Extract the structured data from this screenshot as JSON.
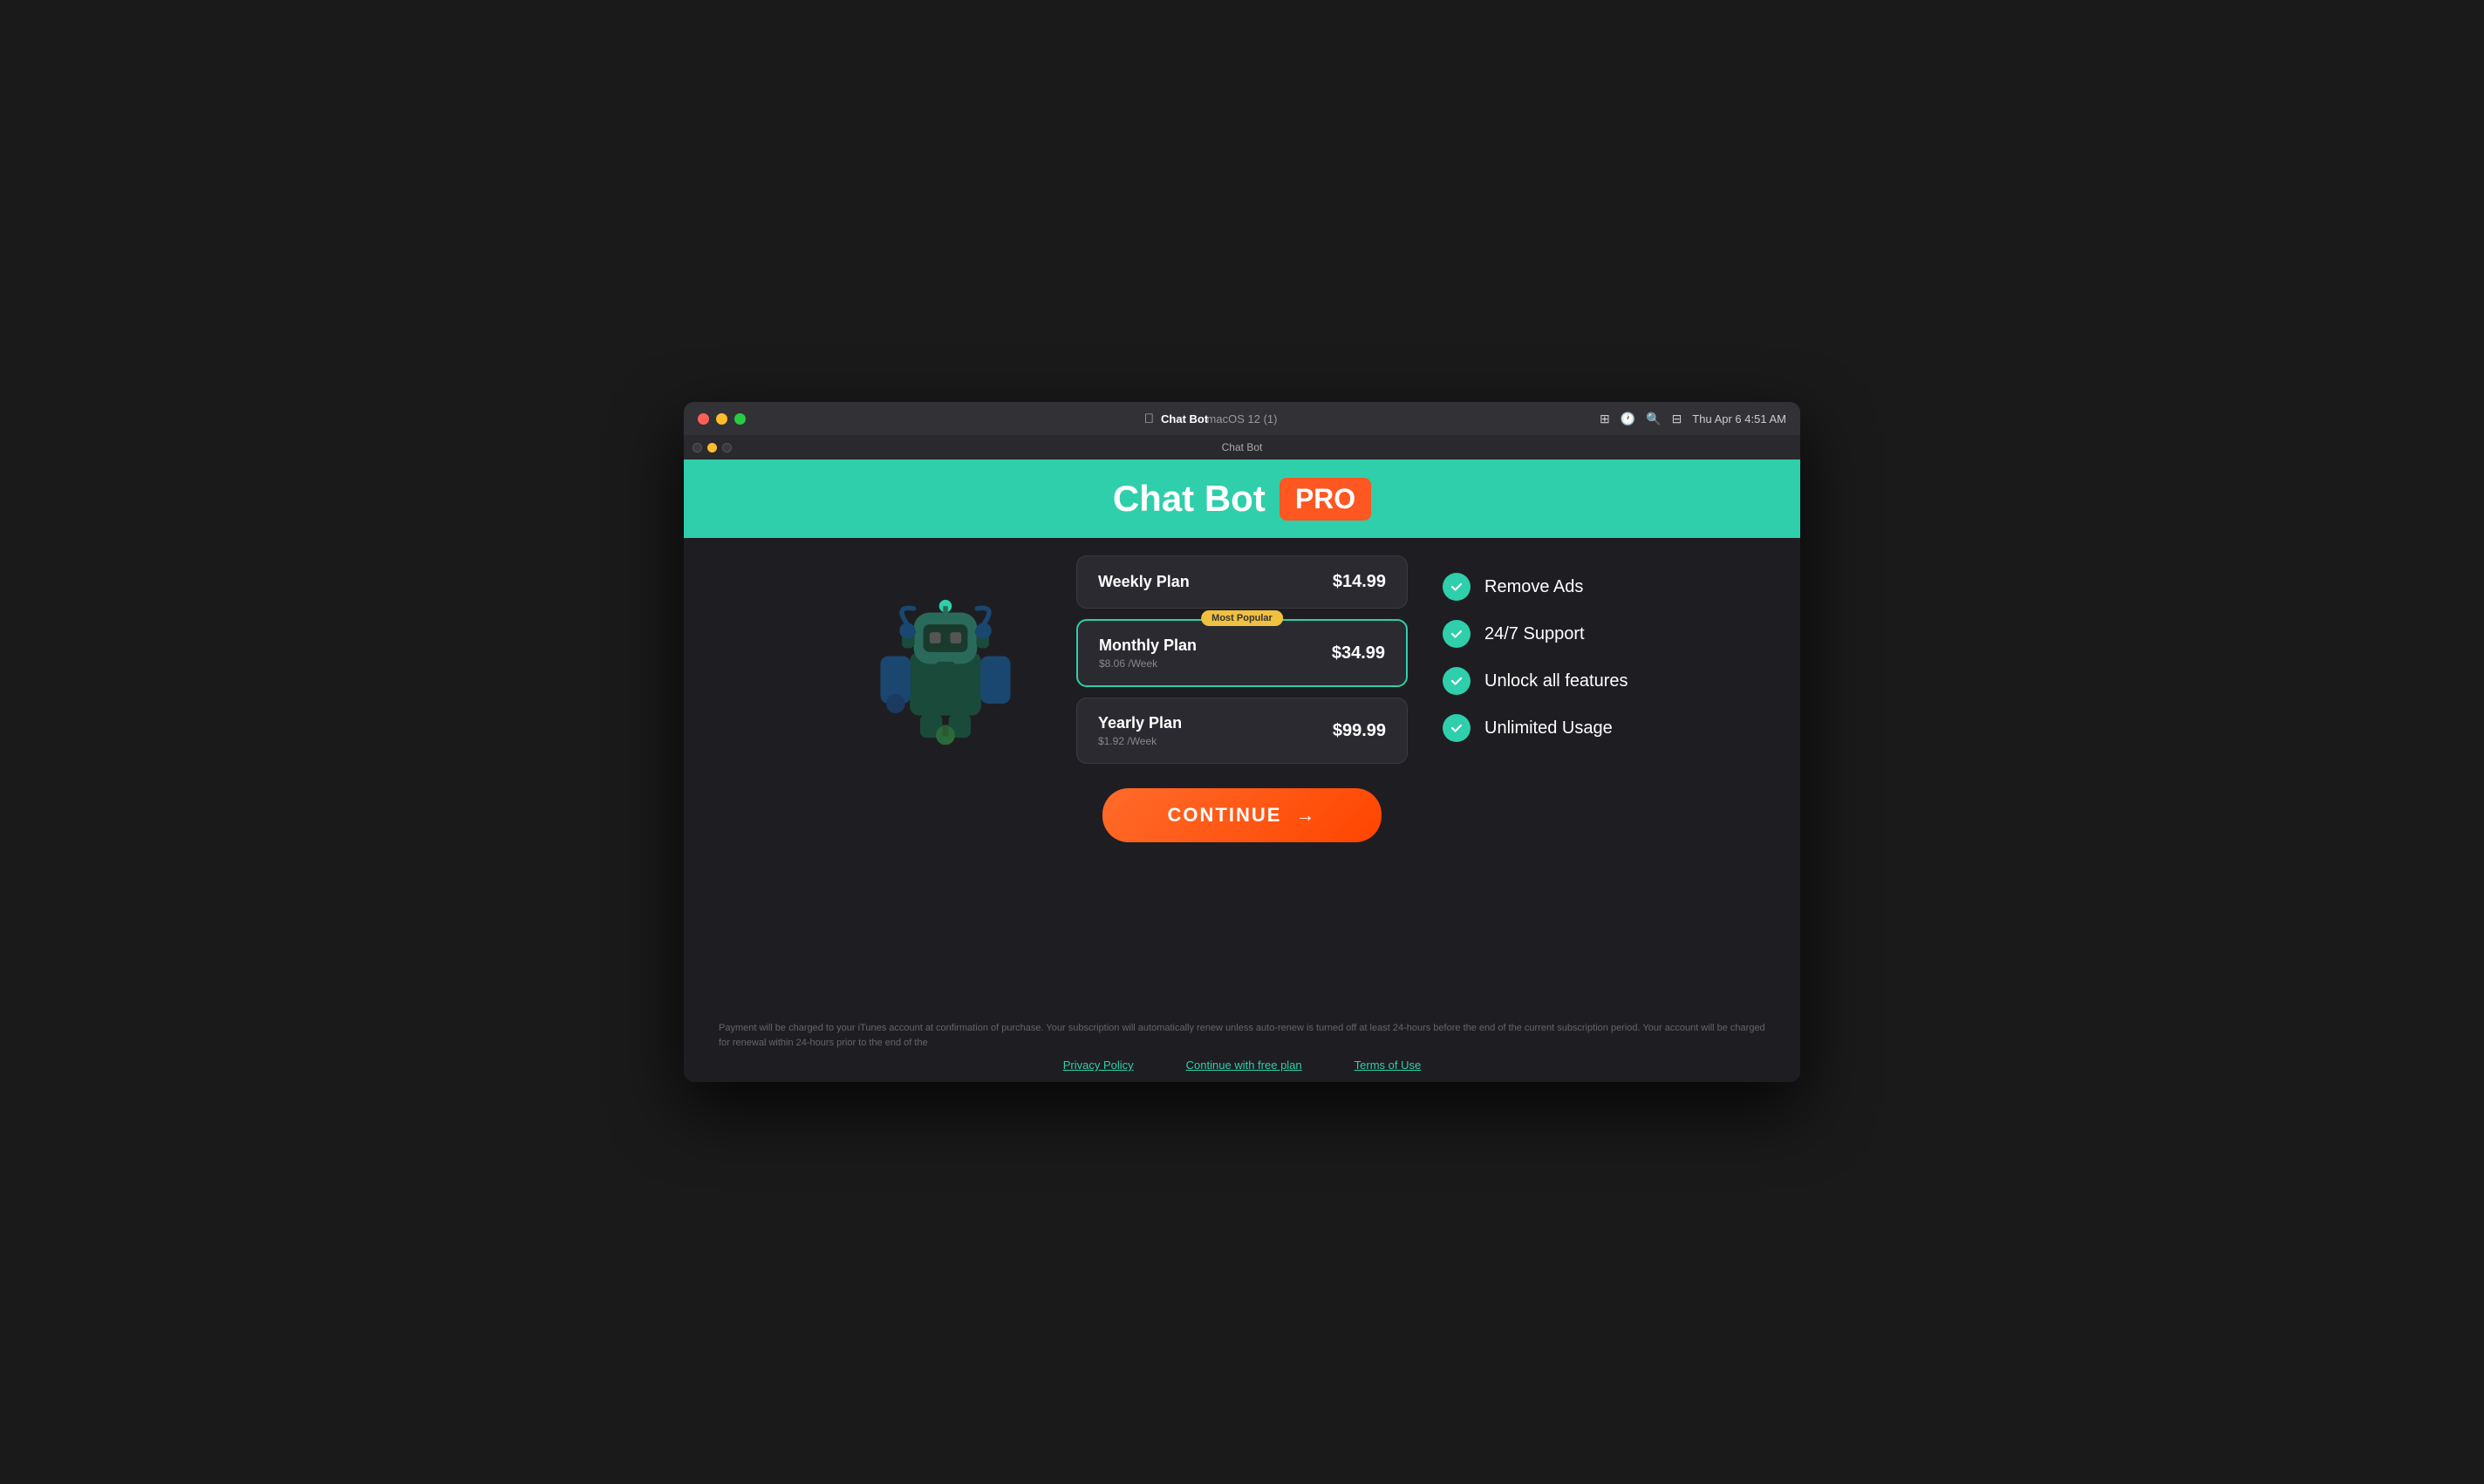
{
  "system": {
    "window_title": "macOS 12 (1)",
    "app_name": "Chat Bot",
    "time": "Thu Apr 6  4:51 AM",
    "traffic_lights": [
      "close",
      "minimize",
      "maximize"
    ]
  },
  "header": {
    "app_name": "Chat Bot",
    "pro_label": "PRO"
  },
  "plans": [
    {
      "id": "weekly",
      "name": "Weekly Plan",
      "price": "$14.99",
      "subtitle": null,
      "badge": null,
      "selected": false
    },
    {
      "id": "monthly",
      "name": "Monthly Plan",
      "price": "$34.99",
      "subtitle": "$8.06 /Week",
      "badge": "Most Popular",
      "selected": true
    },
    {
      "id": "yearly",
      "name": "Yearly Plan",
      "price": "$99.99",
      "subtitle": "$1.92 /Week",
      "badge": null,
      "selected": false
    }
  ],
  "features": [
    {
      "text": "Remove Ads"
    },
    {
      "text": "24/7 Support"
    },
    {
      "text": "Unlock all features"
    },
    {
      "text": "Unlimited Usage"
    }
  ],
  "continue_button": {
    "label": "CONTINUE",
    "arrow": "→"
  },
  "footer": {
    "disclaimer": "Payment will be charged to your iTunes account at confirmation of purchase. Your subscription will automatically renew unless auto-renew is turned off at least 24-hours before the end of the current subscription period. Your account will be charged for renewal within 24-hours prior to the end of the",
    "links": [
      {
        "label": "Privacy Policy"
      },
      {
        "label": "Continue with free plan"
      },
      {
        "label": "Terms of Use"
      }
    ]
  },
  "app_titlebar": {
    "title": "Chat Bot"
  }
}
